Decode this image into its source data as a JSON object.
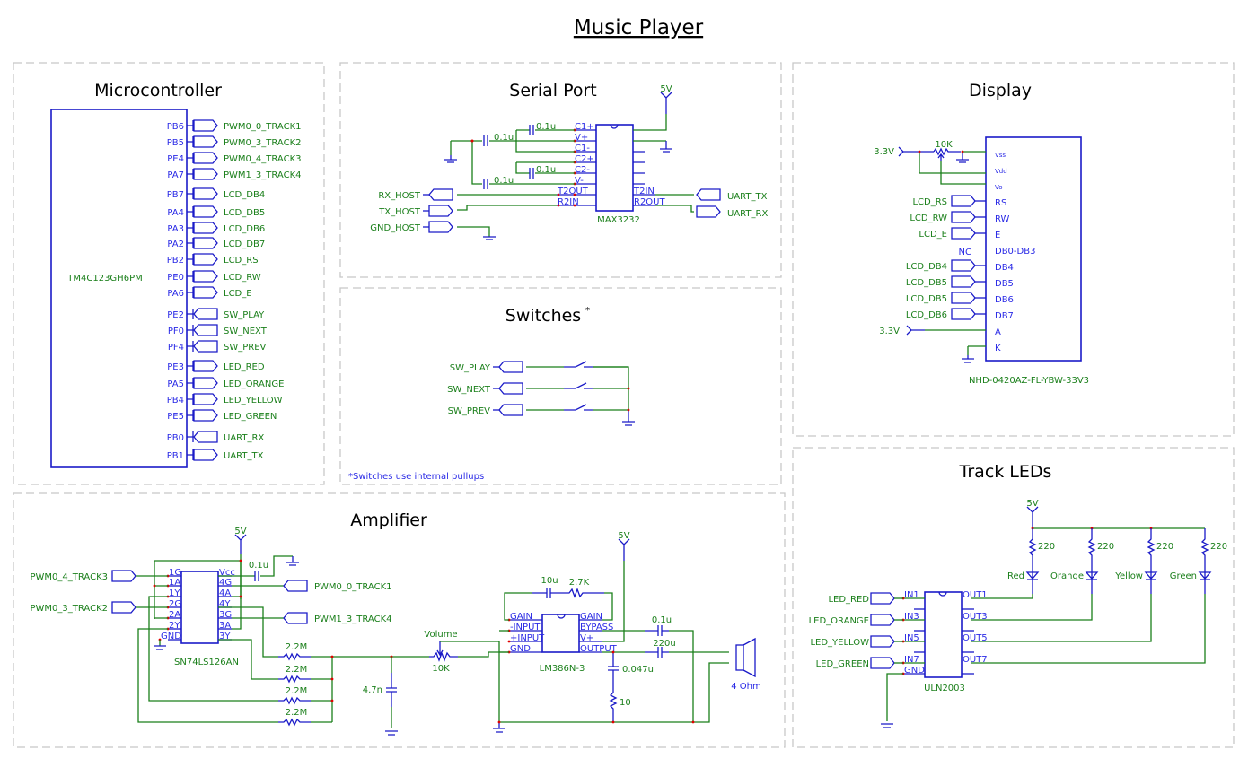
{
  "page": {
    "title": "Music Player"
  },
  "sections": {
    "microcontroller": {
      "title": "Microcontroller",
      "part": "TM4C123GH6PM",
      "pins": [
        {
          "pin": "PB6",
          "net": "PWM0_0_TRACK1",
          "dir": "out"
        },
        {
          "pin": "PB5",
          "net": "PWM0_3_TRACK2",
          "dir": "out"
        },
        {
          "pin": "PE4",
          "net": "PWM0_4_TRACK3",
          "dir": "out"
        },
        {
          "pin": "PA7",
          "net": "PWM1_3_TRACK4",
          "dir": "out"
        },
        {
          "pin": "PB7",
          "net": "LCD_DB4",
          "dir": "out"
        },
        {
          "pin": "PA4",
          "net": "LCD_DB5",
          "dir": "out"
        },
        {
          "pin": "PA3",
          "net": "LCD_DB6",
          "dir": "out"
        },
        {
          "pin": "PA2",
          "net": "LCD_DB7",
          "dir": "out"
        },
        {
          "pin": "PB2",
          "net": "LCD_RS",
          "dir": "out"
        },
        {
          "pin": "PE0",
          "net": "LCD_RW",
          "dir": "out"
        },
        {
          "pin": "PA6",
          "net": "LCD_E",
          "dir": "out"
        },
        {
          "pin": "PE2",
          "net": "SW_PLAY",
          "dir": "in"
        },
        {
          "pin": "PF0",
          "net": "SW_NEXT",
          "dir": "in"
        },
        {
          "pin": "PF4",
          "net": "SW_PREV",
          "dir": "in"
        },
        {
          "pin": "PE3",
          "net": "LED_RED",
          "dir": "out"
        },
        {
          "pin": "PA5",
          "net": "LED_ORANGE",
          "dir": "out"
        },
        {
          "pin": "PB4",
          "net": "LED_YELLOW",
          "dir": "out"
        },
        {
          "pin": "PE5",
          "net": "LED_GREEN",
          "dir": "out"
        },
        {
          "pin": "PB0",
          "net": "UART_RX",
          "dir": "in"
        },
        {
          "pin": "PB1",
          "net": "UART_TX",
          "dir": "out"
        }
      ]
    },
    "serial": {
      "title": "Serial Port",
      "part": "MAX3232",
      "supply": "5V",
      "left_pins": [
        "C1+",
        "V+",
        "C1-",
        "C2+",
        "C2-",
        "V-",
        "T2OUT",
        "R2IN"
      ],
      "right_pins": [
        "T2IN",
        "R2OUT"
      ],
      "caps": [
        "0.1u",
        "0.1u",
        "0.1u",
        "0.1u"
      ],
      "host_ports": [
        "RX_HOST",
        "TX_HOST",
        "GND_HOST"
      ],
      "uart_ports": [
        "UART_TX",
        "UART_RX"
      ]
    },
    "switches": {
      "title": "Switches",
      "title_mark": "*",
      "ports": [
        "SW_PLAY",
        "SW_NEXT",
        "SW_PREV"
      ],
      "footnote": "*Switches use internal pullups"
    },
    "display": {
      "title": "Display",
      "part": "NHD-0420AZ-FL-YBW-33V3",
      "supply": "3.3V",
      "pot": "10K",
      "nc_label": "NC",
      "pins": [
        "Vss",
        "Vdd",
        "Vo",
        "RS",
        "RW",
        "E",
        "DB0-DB3",
        "DB4",
        "DB5",
        "DB6",
        "DB7",
        "A",
        "K"
      ],
      "ports": [
        "LCD_RS",
        "LCD_RW",
        "LCD_E",
        "LCD_DB4",
        "LCD_DB5",
        "LCD_DB5",
        "LCD_DB6"
      ]
    },
    "leds": {
      "title": "Track LEDs",
      "supply": "5V",
      "part": "ULN2003",
      "resistors": [
        "220",
        "220",
        "220",
        "220"
      ],
      "led_names": [
        "Red",
        "Orange",
        "Yellow",
        "Green"
      ],
      "ports": [
        "LED_RED",
        "LED_ORANGE",
        "LED_YELLOW",
        "LED_GREEN"
      ],
      "in_pins": [
        "IN1",
        "IN3",
        "IN5",
        "IN7",
        "GND"
      ],
      "out_pins": [
        "OUT1",
        "OUT3",
        "OUT5",
        "OUT7"
      ]
    },
    "amplifier": {
      "title": "Amplifier",
      "buffer_part": "SN74LS126AN",
      "buffer_left_pins": [
        "1G",
        "1A",
        "1Y",
        "2G",
        "2A",
        "2Y",
        "GND"
      ],
      "buffer_right_pins": [
        "Vcc",
        "4G",
        "4A",
        "4Y",
        "3G",
        "3A",
        "3Y"
      ],
      "supply": "5V",
      "decoupling_cap": "0.1u",
      "in_ports": [
        "PWM0_4_TRACK3",
        "PWM0_3_TRACK2"
      ],
      "out_ports": [
        "PWM0_0_TRACK1",
        "PWM1_3_TRACK4"
      ],
      "mix_resistors": [
        "2.2M",
        "2.2M",
        "2.2M",
        "2.2M"
      ],
      "filter_cap": "4.7n",
      "volume_label": "Volume",
      "volume_value": "10K",
      "amp_part": "LM386N-3",
      "amp_left_pins": [
        "GAIN",
        "-INPUT",
        "+INPUT",
        "GND"
      ],
      "amp_right_pins": [
        "GAIN",
        "BYPASS",
        "V+",
        "OUTPUT"
      ],
      "gain_cap": "10u",
      "gain_res": "2.7K",
      "bypass_cap": "0.1u",
      "output_cap": "220u",
      "zobel_cap": "0.047u",
      "zobel_res": "10",
      "speaker": "4 Ohm"
    }
  }
}
